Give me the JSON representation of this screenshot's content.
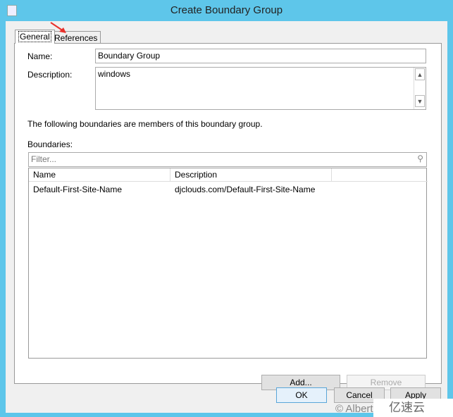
{
  "window": {
    "title": "Create Boundary Group",
    "icon": "document-icon"
  },
  "tabs": [
    {
      "label": "General",
      "active": true
    },
    {
      "label": "References",
      "active": false
    }
  ],
  "form": {
    "name_label": "Name:",
    "name_value": "Boundary Group",
    "description_label": "Description:",
    "description_value": "windows",
    "members_text": "The following boundaries are members of this boundary group.",
    "boundaries_label": "Boundaries:",
    "filter_placeholder": "Filter..."
  },
  "table": {
    "columns": [
      "Name",
      "Description"
    ],
    "rows": [
      {
        "name": "Default-First-Site-Name",
        "description": "djclouds.com/Default-First-Site-Name"
      }
    ]
  },
  "buttons": {
    "add": "Add...",
    "remove": "Remove",
    "ok": "OK",
    "cancel": "Cancel",
    "apply": "Apply"
  },
  "watermark": {
    "text": "© Albert",
    "logo": "亿速云"
  },
  "colors": {
    "titlebar": "#5ec6ea",
    "annotation_arrow": "#e8302a"
  }
}
